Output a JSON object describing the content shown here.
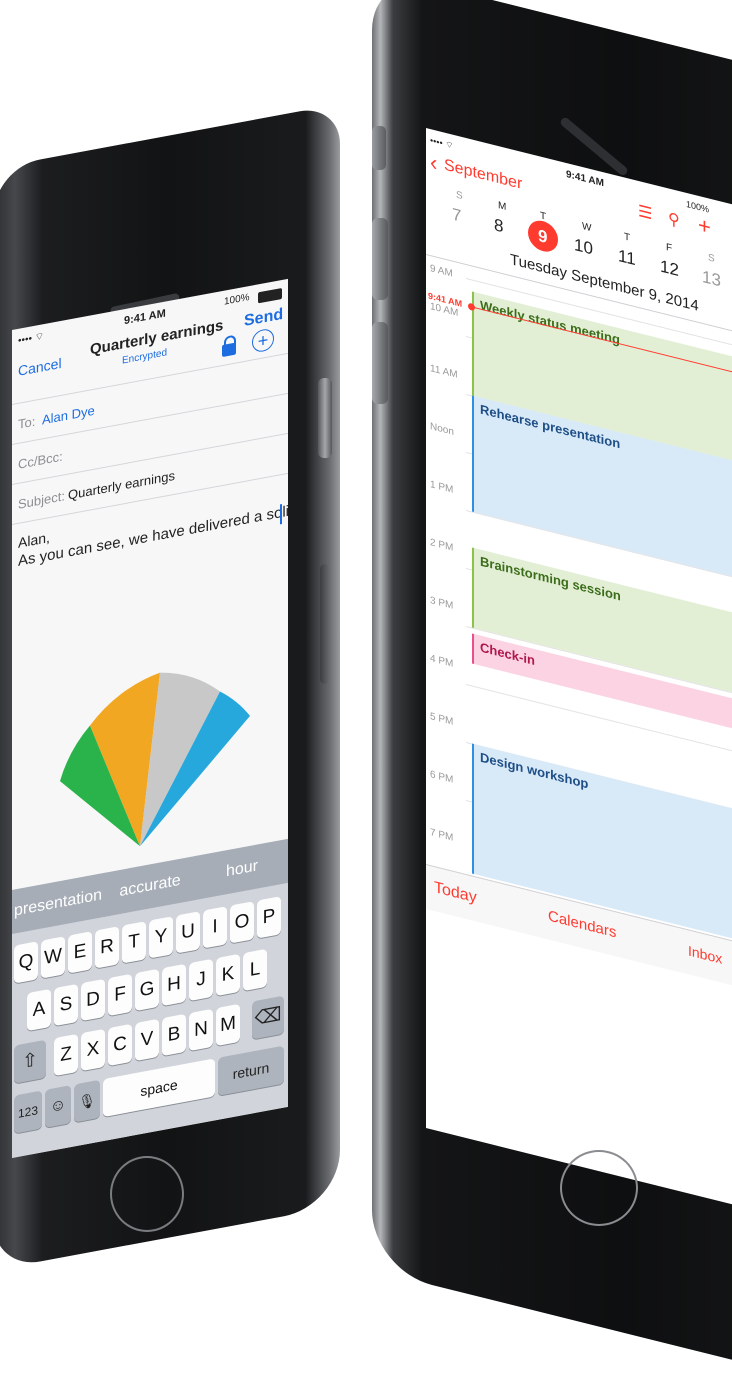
{
  "mail": {
    "status": {
      "signal": "•••• ⌔",
      "time": "9:41 AM",
      "battery": "100%"
    },
    "nav": {
      "cancel": "Cancel",
      "title": "Quarterly earnings",
      "subtitle": "Encrypted",
      "send": "Send"
    },
    "to": {
      "label": "To:",
      "value": "Alan Dye"
    },
    "ccbcc": {
      "label": "Cc/Bcc:"
    },
    "subject": {
      "label": "Subject:",
      "value": "Quarterly earnings"
    },
    "body": {
      "line1": "Alan,",
      "line2": "As you can see, we have delivered a solid"
    },
    "suggestions": [
      "presentation",
      "accurate",
      "hour"
    ],
    "keyboard": {
      "row1": [
        "Q",
        "W",
        "E",
        "R",
        "T",
        "Y",
        "U",
        "I",
        "O",
        "P"
      ],
      "row2": [
        "A",
        "S",
        "D",
        "F",
        "G",
        "H",
        "J",
        "K",
        "L"
      ],
      "row3": [
        "Z",
        "X",
        "C",
        "V",
        "B",
        "N",
        "M"
      ],
      "shift_icon": "shift-icon",
      "delete_icon": "delete-icon",
      "numbers": "123",
      "emoji_icon": "emoji-icon",
      "mic_icon": "microphone-icon",
      "space": "space",
      "return": "return"
    },
    "pie_colors": [
      "#2ab34a",
      "#f2a722",
      "#c8c8c8",
      "#26a8dc"
    ]
  },
  "calendar": {
    "status": {
      "signal": "•••• ⌔",
      "time": "9:41 AM",
      "battery": "100%"
    },
    "back": "September",
    "weekdays": [
      "S",
      "M",
      "T",
      "W",
      "T",
      "F",
      "S"
    ],
    "days": [
      "7",
      "8",
      "9",
      "10",
      "11",
      "12",
      "13"
    ],
    "selected_day": "9",
    "date_title": "Tuesday  September 9, 2014",
    "hours": [
      "9 AM",
      "10 AM",
      "11 AM",
      "Noon",
      "1 PM",
      "2 PM",
      "3 PM",
      "4 PM",
      "5 PM",
      "6 PM",
      "7 PM"
    ],
    "now_label": "9:41 AM",
    "events": [
      {
        "title": "Weekly status meeting",
        "color": "#e3efd5",
        "border": "#8bc34a",
        "text": "#3b6d1a"
      },
      {
        "title": "Rehearse presentation",
        "color": "#d8e9f8",
        "border": "#2f8fe0",
        "text": "#1d4e86"
      },
      {
        "title": "Brainstorming session",
        "color": "#e3efd5",
        "border": "#8bc34a",
        "text": "#3b6d1a"
      },
      {
        "title": "Check-in",
        "color": "#fbd3e3",
        "border": "#e94f8a",
        "text": "#b0174a"
      },
      {
        "title": "Design workshop",
        "color": "#d8e9f8",
        "border": "#2f8fe0",
        "text": "#1d4e86"
      }
    ],
    "toolbar": {
      "today": "Today",
      "calendars": "Calendars",
      "inbox": "Inbox"
    },
    "accent": "#ff3b30"
  }
}
